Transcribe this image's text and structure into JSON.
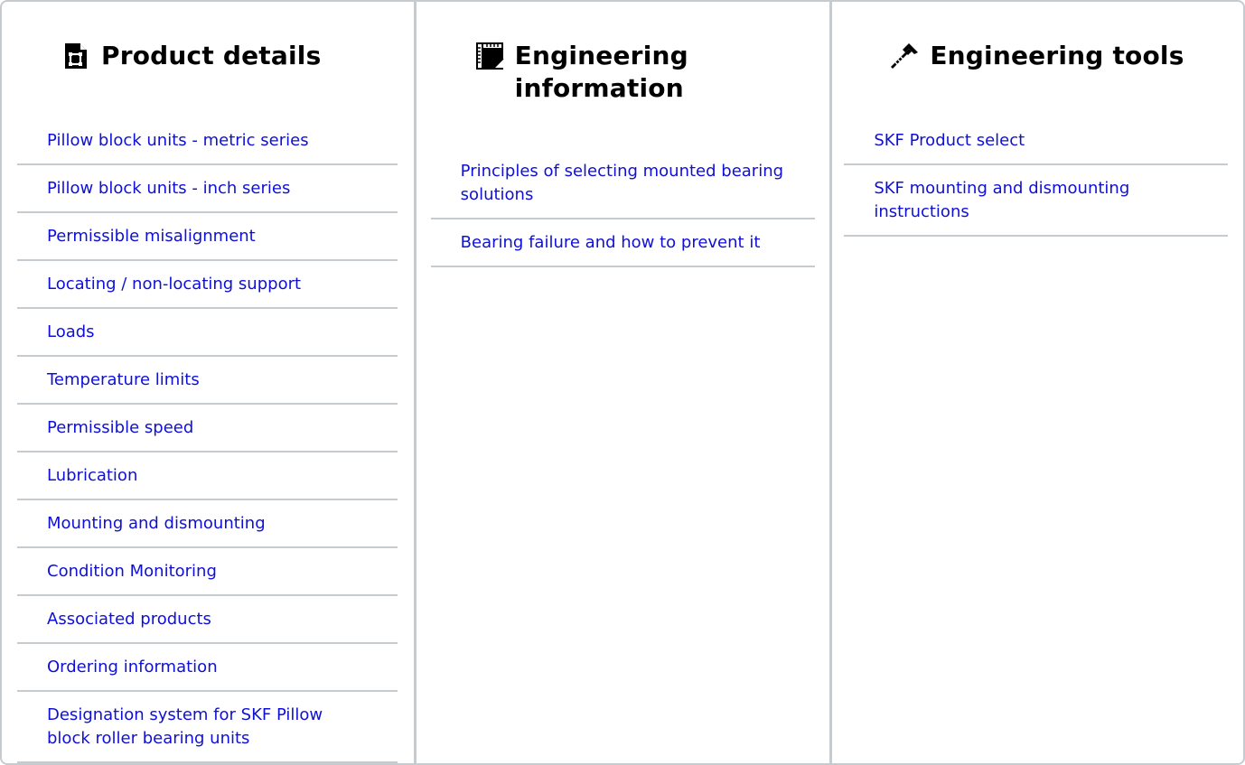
{
  "columns": [
    {
      "title": "Product details",
      "icon": "document-icon",
      "links": [
        "Pillow block units - metric series",
        "Pillow block units - inch series",
        "Permissible misalignment",
        "Locating / non-locating support",
        "Loads",
        "Temperature limits",
        "Permissible speed",
        "Lubrication",
        "Mounting and dismounting",
        "Condition Monitoring",
        "Associated products",
        "Ordering information",
        "Designation system for SKF Pillow block roller bearing units"
      ]
    },
    {
      "title": "Engineering information",
      "icon": "blueprint-icon",
      "links": [
        "Principles of selecting mounted bearing solutions",
        "Bearing failure and how to prevent it"
      ]
    },
    {
      "title": "Engineering tools",
      "icon": "tools-icon",
      "links": [
        "SKF Product select",
        "SKF mounting and dismounting instructions"
      ]
    }
  ],
  "colors": {
    "link": "#0f10d6",
    "divider": "#c6cbd0",
    "title": "#000000"
  }
}
